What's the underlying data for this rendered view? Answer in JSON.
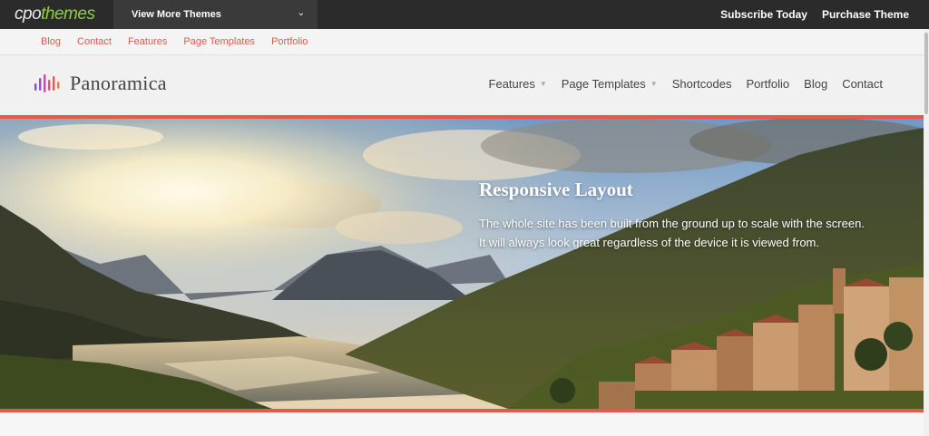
{
  "topbar": {
    "brand_part1": "cpo",
    "brand_part2": "themes",
    "theme_select_label": "View More Themes",
    "subscribe_label": "Subscribe Today",
    "purchase_label": "Purchase Theme"
  },
  "subnav": [
    "Blog",
    "Contact",
    "Features",
    "Page Templates",
    "Portfolio"
  ],
  "site": {
    "name": "Panoramica",
    "nav": [
      {
        "label": "Features",
        "dropdown": true
      },
      {
        "label": "Page Templates",
        "dropdown": true
      },
      {
        "label": "Shortcodes",
        "dropdown": false
      },
      {
        "label": "Portfolio",
        "dropdown": false
      },
      {
        "label": "Blog",
        "dropdown": false
      },
      {
        "label": "Contact",
        "dropdown": false
      }
    ]
  },
  "hero": {
    "title": "Responsive Layout",
    "body": "The whole site has been built from the ground up to scale with the screen. It will always look great regardless of the device it is viewed from."
  },
  "colors": {
    "accent": "#e6584d",
    "topbar": "#2b2b2b",
    "brand_green": "#8fcf3c"
  },
  "icons": {
    "theme_select": "chevron-down-icon",
    "nav_dropdown": "caret-down-icon",
    "logo": "equalizer-bars-logo"
  }
}
